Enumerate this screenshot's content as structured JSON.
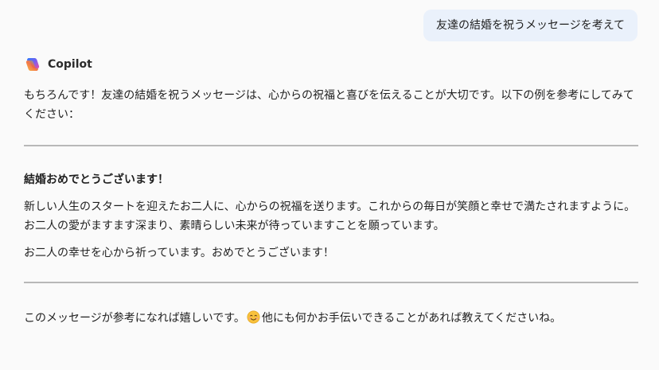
{
  "user_message": "友達の結婚を祝うメッセージを考えて",
  "assistant": {
    "name": "Copilot",
    "intro": "もちろんです！友達の結婚を祝うメッセージは、心からの祝福と喜びを伝えることが大切です。以下の例を参考にしてみてください：",
    "message_title": "結婚おめでとうございます！",
    "message_body_1": "新しい人生のスタートを迎えたお二人に、心からの祝福を送ります。これからの毎日が笑顔と幸せで満たされますように。お二人の愛がますます深まり、素晴らしい未来が待っていますことを願っています。",
    "message_body_2": "お二人の幸せを心から祈っています。おめでとうございます！",
    "closing_before": "このメッセージが参考になれば嬉しいです。",
    "closing_emoji": "smiling-face-icon",
    "closing_after": "他にも何かお手伝いできることがあれば教えてくださいね。"
  },
  "colors": {
    "background": "#fafafa",
    "user_bubble": "#eaf1fb",
    "divider": "#b8b8b8",
    "text": "#1f1f1f"
  }
}
